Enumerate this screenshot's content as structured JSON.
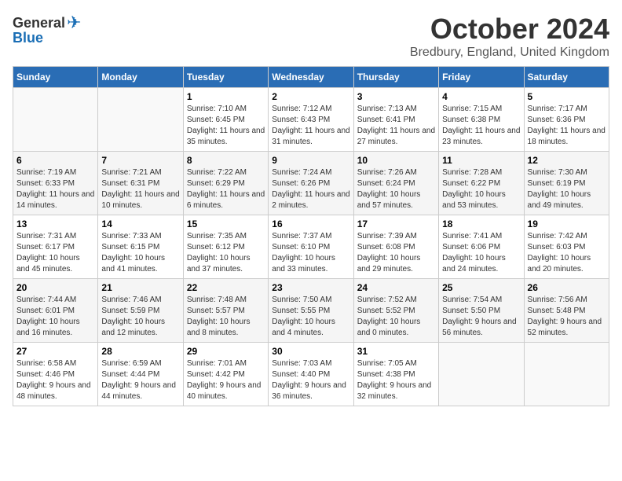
{
  "logo": {
    "general": "General",
    "blue": "Blue"
  },
  "title": {
    "month": "October 2024",
    "location": "Bredbury, England, United Kingdom"
  },
  "weekdays": [
    "Sunday",
    "Monday",
    "Tuesday",
    "Wednesday",
    "Thursday",
    "Friday",
    "Saturday"
  ],
  "weeks": [
    [
      {
        "day": "",
        "info": ""
      },
      {
        "day": "",
        "info": ""
      },
      {
        "day": "1",
        "info": "Sunrise: 7:10 AM\nSunset: 6:45 PM\nDaylight: 11 hours and 35 minutes."
      },
      {
        "day": "2",
        "info": "Sunrise: 7:12 AM\nSunset: 6:43 PM\nDaylight: 11 hours and 31 minutes."
      },
      {
        "day": "3",
        "info": "Sunrise: 7:13 AM\nSunset: 6:41 PM\nDaylight: 11 hours and 27 minutes."
      },
      {
        "day": "4",
        "info": "Sunrise: 7:15 AM\nSunset: 6:38 PM\nDaylight: 11 hours and 23 minutes."
      },
      {
        "day": "5",
        "info": "Sunrise: 7:17 AM\nSunset: 6:36 PM\nDaylight: 11 hours and 18 minutes."
      }
    ],
    [
      {
        "day": "6",
        "info": "Sunrise: 7:19 AM\nSunset: 6:33 PM\nDaylight: 11 hours and 14 minutes."
      },
      {
        "day": "7",
        "info": "Sunrise: 7:21 AM\nSunset: 6:31 PM\nDaylight: 11 hours and 10 minutes."
      },
      {
        "day": "8",
        "info": "Sunrise: 7:22 AM\nSunset: 6:29 PM\nDaylight: 11 hours and 6 minutes."
      },
      {
        "day": "9",
        "info": "Sunrise: 7:24 AM\nSunset: 6:26 PM\nDaylight: 11 hours and 2 minutes."
      },
      {
        "day": "10",
        "info": "Sunrise: 7:26 AM\nSunset: 6:24 PM\nDaylight: 10 hours and 57 minutes."
      },
      {
        "day": "11",
        "info": "Sunrise: 7:28 AM\nSunset: 6:22 PM\nDaylight: 10 hours and 53 minutes."
      },
      {
        "day": "12",
        "info": "Sunrise: 7:30 AM\nSunset: 6:19 PM\nDaylight: 10 hours and 49 minutes."
      }
    ],
    [
      {
        "day": "13",
        "info": "Sunrise: 7:31 AM\nSunset: 6:17 PM\nDaylight: 10 hours and 45 minutes."
      },
      {
        "day": "14",
        "info": "Sunrise: 7:33 AM\nSunset: 6:15 PM\nDaylight: 10 hours and 41 minutes."
      },
      {
        "day": "15",
        "info": "Sunrise: 7:35 AM\nSunset: 6:12 PM\nDaylight: 10 hours and 37 minutes."
      },
      {
        "day": "16",
        "info": "Sunrise: 7:37 AM\nSunset: 6:10 PM\nDaylight: 10 hours and 33 minutes."
      },
      {
        "day": "17",
        "info": "Sunrise: 7:39 AM\nSunset: 6:08 PM\nDaylight: 10 hours and 29 minutes."
      },
      {
        "day": "18",
        "info": "Sunrise: 7:41 AM\nSunset: 6:06 PM\nDaylight: 10 hours and 24 minutes."
      },
      {
        "day": "19",
        "info": "Sunrise: 7:42 AM\nSunset: 6:03 PM\nDaylight: 10 hours and 20 minutes."
      }
    ],
    [
      {
        "day": "20",
        "info": "Sunrise: 7:44 AM\nSunset: 6:01 PM\nDaylight: 10 hours and 16 minutes."
      },
      {
        "day": "21",
        "info": "Sunrise: 7:46 AM\nSunset: 5:59 PM\nDaylight: 10 hours and 12 minutes."
      },
      {
        "day": "22",
        "info": "Sunrise: 7:48 AM\nSunset: 5:57 PM\nDaylight: 10 hours and 8 minutes."
      },
      {
        "day": "23",
        "info": "Sunrise: 7:50 AM\nSunset: 5:55 PM\nDaylight: 10 hours and 4 minutes."
      },
      {
        "day": "24",
        "info": "Sunrise: 7:52 AM\nSunset: 5:52 PM\nDaylight: 10 hours and 0 minutes."
      },
      {
        "day": "25",
        "info": "Sunrise: 7:54 AM\nSunset: 5:50 PM\nDaylight: 9 hours and 56 minutes."
      },
      {
        "day": "26",
        "info": "Sunrise: 7:56 AM\nSunset: 5:48 PM\nDaylight: 9 hours and 52 minutes."
      }
    ],
    [
      {
        "day": "27",
        "info": "Sunrise: 6:58 AM\nSunset: 4:46 PM\nDaylight: 9 hours and 48 minutes."
      },
      {
        "day": "28",
        "info": "Sunrise: 6:59 AM\nSunset: 4:44 PM\nDaylight: 9 hours and 44 minutes."
      },
      {
        "day": "29",
        "info": "Sunrise: 7:01 AM\nSunset: 4:42 PM\nDaylight: 9 hours and 40 minutes."
      },
      {
        "day": "30",
        "info": "Sunrise: 7:03 AM\nSunset: 4:40 PM\nDaylight: 9 hours and 36 minutes."
      },
      {
        "day": "31",
        "info": "Sunrise: 7:05 AM\nSunset: 4:38 PM\nDaylight: 9 hours and 32 minutes."
      },
      {
        "day": "",
        "info": ""
      },
      {
        "day": "",
        "info": ""
      }
    ]
  ]
}
